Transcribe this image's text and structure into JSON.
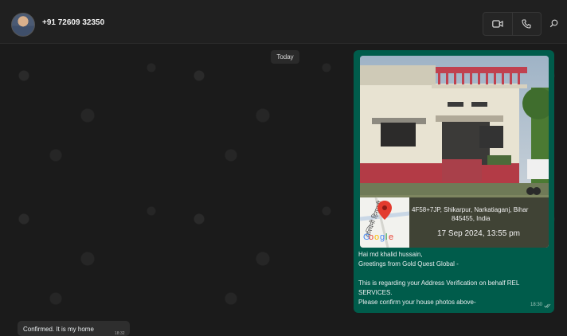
{
  "header": {
    "contact_name": "+91 72609 32350"
  },
  "chat": {
    "date_label": "Today",
    "outgoing": {
      "location_text_1": "4F58+7JP, Shikarpur, Narkatiaganj, Bihar",
      "location_text_2": "845455, India",
      "photo_timestamp": "17 Sep 2024, 13:55 pm",
      "map_brand": "Google",
      "line_1": "Hai  md khalid hussain,",
      "line_2": "Greetings from Gold Quest Global -",
      "line_3": "This is regarding your Address Verification on behalf REL",
      "line_4": "SERVICES.",
      "line_5": "Please confirm your house photos above-",
      "time": "18:30"
    },
    "incoming": {
      "text": "Confirmed. It is my home",
      "time": "18:32"
    }
  },
  "colors": {
    "outgoing_bubble": "#005c4b",
    "incoming_bubble": "#2e2e2e",
    "background": "#1b1b1b",
    "map_pin": "#e33b2e"
  },
  "icons": {
    "video": "video-camera-icon",
    "voice": "phone-icon",
    "search": "search-icon",
    "read_receipt": "double-check-icon",
    "map_pin": "map-pin-icon"
  }
}
